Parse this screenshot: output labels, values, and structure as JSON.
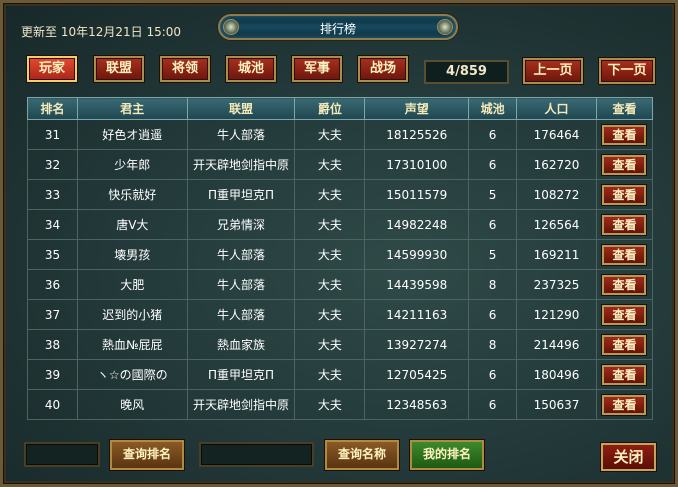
{
  "header": {
    "update_text": "更新至 10年12月21日 15:00",
    "title": "排行榜"
  },
  "categories": [
    {
      "label": "玩家",
      "active": true
    },
    {
      "label": "联盟",
      "active": false
    },
    {
      "label": "将领",
      "active": false
    },
    {
      "label": "城池",
      "active": false
    },
    {
      "label": "军事",
      "active": false
    },
    {
      "label": "战场",
      "active": false
    }
  ],
  "pager": {
    "page_info": "4/859",
    "prev_label": "上一页",
    "next_label": "下一页"
  },
  "table": {
    "columns": [
      "排名",
      "君主",
      "联盟",
      "爵位",
      "声望",
      "城池",
      "人口",
      "查看"
    ],
    "view_label": "查看",
    "rows": [
      {
        "rank": "31",
        "lord": "好色オ逍遥",
        "alliance": "牛人部落",
        "title": "大夫",
        "prestige": "18125526",
        "cities": "6",
        "population": "176464"
      },
      {
        "rank": "32",
        "lord": "少年郎",
        "alliance": "开天辟地剑指中原",
        "title": "大夫",
        "prestige": "17310100",
        "cities": "6",
        "population": "162720"
      },
      {
        "rank": "33",
        "lord": "快乐就好",
        "alliance": "Π重甲坦克Π",
        "title": "大夫",
        "prestige": "15011579",
        "cities": "5",
        "population": "108272"
      },
      {
        "rank": "34",
        "lord": "唐V大",
        "alliance": "兄弟情深",
        "title": "大夫",
        "prestige": "14982248",
        "cities": "6",
        "population": "126564"
      },
      {
        "rank": "35",
        "lord": "壊男孩",
        "alliance": "牛人部落",
        "title": "大夫",
        "prestige": "14599930",
        "cities": "5",
        "population": "169211"
      },
      {
        "rank": "36",
        "lord": "大肥",
        "alliance": "牛人部落",
        "title": "大夫",
        "prestige": "14439598",
        "cities": "8",
        "population": "237325"
      },
      {
        "rank": "37",
        "lord": "迟到的小猪",
        "alliance": "牛人部落",
        "title": "大夫",
        "prestige": "14211163",
        "cities": "6",
        "population": "121290"
      },
      {
        "rank": "38",
        "lord": "熱血№屁屁",
        "alliance": "熱血家族",
        "title": "大夫",
        "prestige": "13927274",
        "cities": "8",
        "population": "214496"
      },
      {
        "rank": "39",
        "lord": "ヽ☆の國際の",
        "alliance": "Π重甲坦克Π",
        "title": "大夫",
        "prestige": "12705425",
        "cities": "6",
        "population": "180496"
      },
      {
        "rank": "40",
        "lord": "晚风",
        "alliance": "开天辟地剑指中原",
        "title": "大夫",
        "prestige": "12348563",
        "cities": "6",
        "population": "150637"
      }
    ]
  },
  "footer": {
    "rank_input_value": "",
    "name_input_value": "",
    "query_rank_label": "查询排名",
    "query_name_label": "查询名称",
    "my_rank_label": "我的排名",
    "close_label": "关闭"
  }
}
